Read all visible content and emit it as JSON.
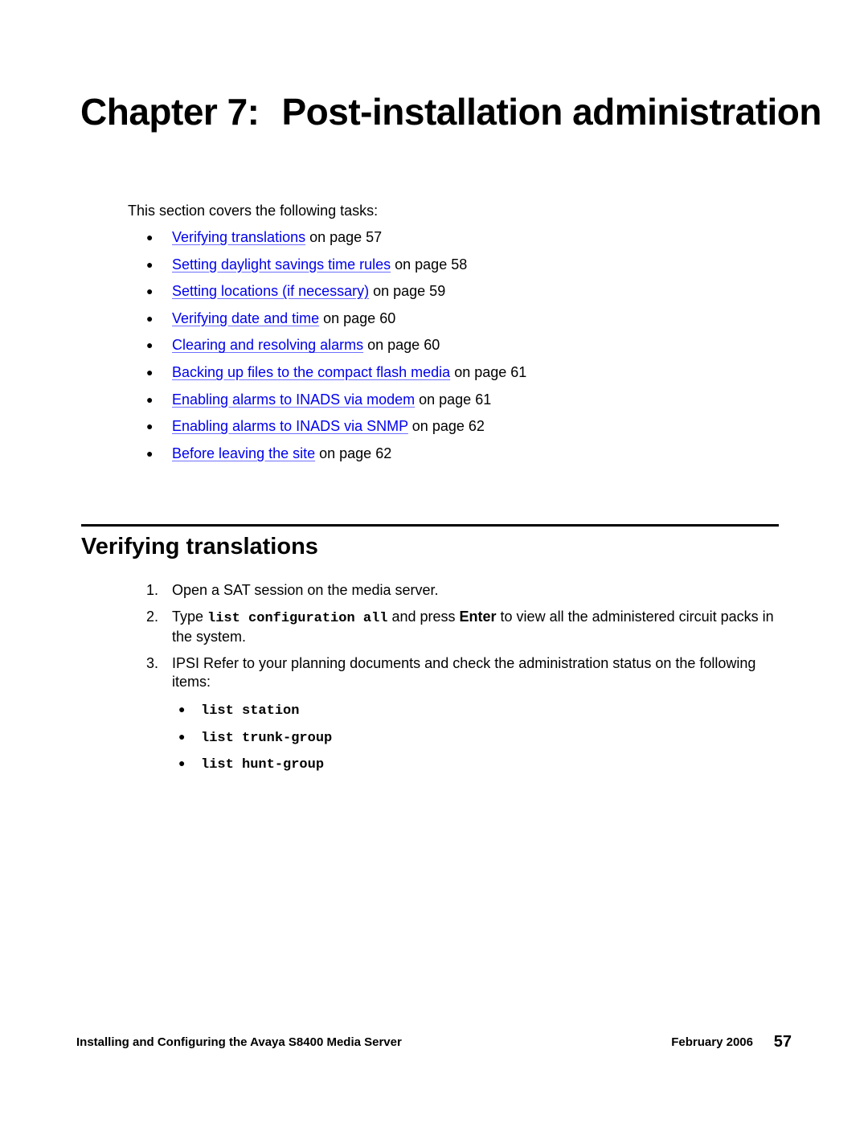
{
  "chapter": {
    "label": "Chapter 7:",
    "title": "Post-installation administration"
  },
  "intro": "This section covers the following tasks:",
  "tasks": [
    {
      "link": "Verifying translations",
      "suffix": " on page 57"
    },
    {
      "link": "Setting daylight savings time rules",
      "suffix": " on page 58"
    },
    {
      "link": "Setting locations (if necessary)",
      "suffix": " on page 59"
    },
    {
      "link": "Verifying date and time",
      "suffix": " on page 60"
    },
    {
      "link": "Clearing and resolving alarms",
      "suffix": " on page 60"
    },
    {
      "link": "Backing up files to the compact flash media",
      "suffix": " on page 61"
    },
    {
      "link": "Enabling alarms to INADS via modem",
      "suffix": " on page 61"
    },
    {
      "link": "Enabling alarms to INADS via SNMP",
      "suffix": " on page 62"
    },
    {
      "link": "Before leaving the site",
      "suffix": " on page 62"
    }
  ],
  "section": {
    "title": "Verifying translations",
    "steps": {
      "s1": {
        "num": "1.",
        "text": "Open a SAT session on the media server."
      },
      "s2": {
        "num": "2.",
        "pre": "Type ",
        "command": "list configuration all",
        "mid": " and press ",
        "key": "Enter",
        "post": " to view all the administered circuit packs in the system."
      },
      "s3": {
        "num": "3.",
        "text": "IPSI Refer to your planning documents and check the administration status on the following items:",
        "items": [
          "list station",
          "list trunk-group",
          "list hunt-group"
        ]
      }
    }
  },
  "footer": {
    "title": "Installing and Configuring the Avaya S8400 Media Server",
    "date": "February 2006",
    "page": "57"
  },
  "glyphs": {
    "bullet": "●"
  }
}
